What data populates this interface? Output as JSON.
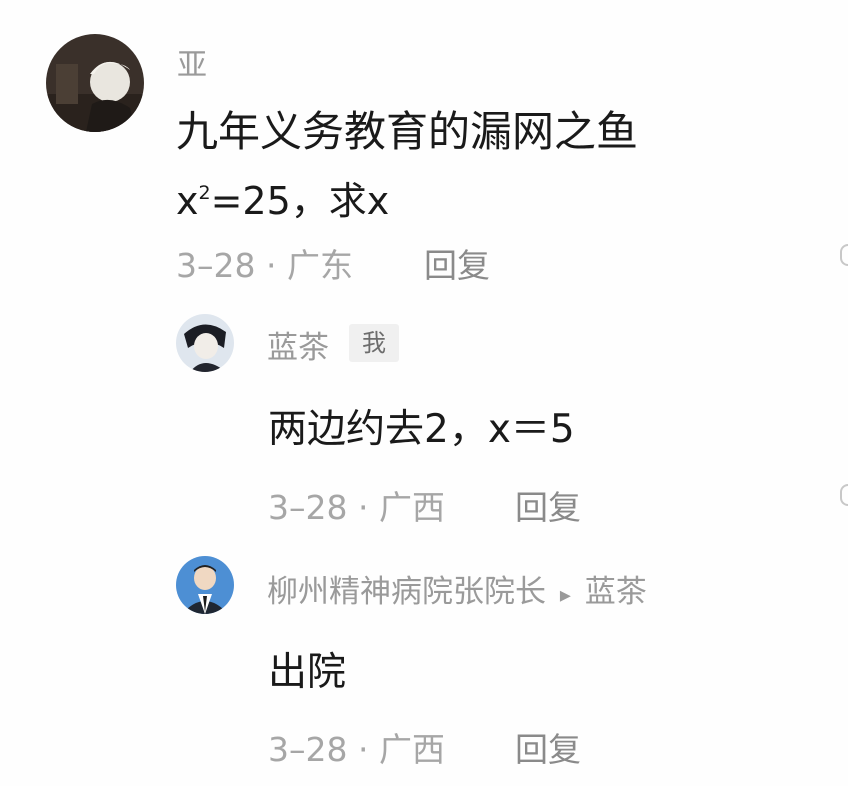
{
  "comments": [
    {
      "username": "亚",
      "text_line1": "九年义务教育的漏网之鱼",
      "text_line2": {
        "pre": "x",
        "sup": "2",
        "post": "=25，求x"
      },
      "date": "3–28",
      "separator": "·",
      "location": "广东",
      "reply_label": "回复"
    }
  ],
  "replies": [
    {
      "username": "蓝茶",
      "badge": "我",
      "text": "两边约去2，x＝5",
      "date": "3–28",
      "separator": "·",
      "location": "广西",
      "reply_label": "回复"
    },
    {
      "username": "柳州精神病院张院长",
      "reply_arrow": "▸",
      "reply_to": "蓝茶",
      "text": "出院",
      "date": "3–28",
      "separator": "·",
      "location": "广西",
      "reply_label": "回复"
    }
  ],
  "colors": {
    "username": "#9a9a9a",
    "body_text": "#1a1a1a",
    "meta": "#a6a6a6",
    "badge_bg": "#f0f0f0"
  }
}
